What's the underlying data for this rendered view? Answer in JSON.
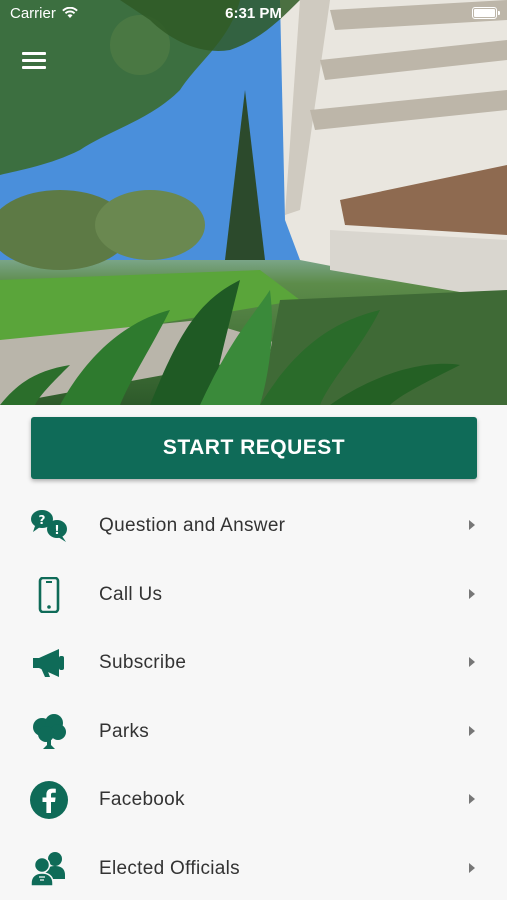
{
  "status_bar": {
    "carrier": "Carrier",
    "time": "6:31 PM"
  },
  "header": {
    "menu_icon": "hamburger-menu-icon",
    "hero_image": "campus-building-and-garden-photo"
  },
  "primary_action": {
    "label": "START REQUEST",
    "color": "#0f6b58"
  },
  "menu": {
    "items": [
      {
        "label": "Question and Answer",
        "icon": "question-chat-icon"
      },
      {
        "label": "Call Us",
        "icon": "phone-icon"
      },
      {
        "label": "Subscribe",
        "icon": "megaphone-icon"
      },
      {
        "label": "Parks",
        "icon": "tree-icon"
      },
      {
        "label": "Facebook",
        "icon": "facebook-icon"
      },
      {
        "label": "Elected Officials",
        "icon": "people-icon"
      }
    ]
  },
  "theme": {
    "accent": "#0f6b58",
    "text": "#333333",
    "background": "#f7f7f7"
  }
}
